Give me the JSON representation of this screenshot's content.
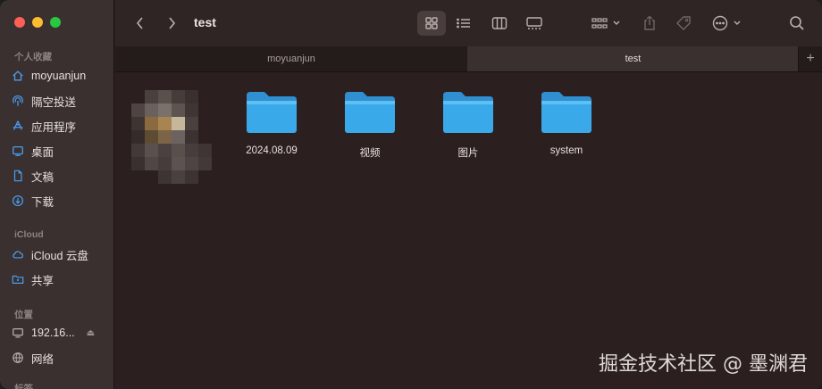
{
  "window": {
    "title": "test"
  },
  "sidebar": {
    "sections": [
      {
        "title": "个人收藏",
        "items": [
          {
            "label": "moyuanjun",
            "icon": "home-icon"
          },
          {
            "label": "隔空投送",
            "icon": "airdrop-icon"
          },
          {
            "label": "应用程序",
            "icon": "applications-icon"
          },
          {
            "label": "桌面",
            "icon": "desktop-icon"
          },
          {
            "label": "文稿",
            "icon": "document-icon"
          },
          {
            "label": "下载",
            "icon": "download-icon"
          }
        ]
      },
      {
        "title": "iCloud",
        "items": [
          {
            "label": "iCloud 云盘",
            "icon": "cloud-icon"
          },
          {
            "label": "共享",
            "icon": "shared-folder-icon"
          }
        ]
      },
      {
        "title": "位置",
        "items": [
          {
            "label": "192.16...",
            "icon": "display-icon"
          },
          {
            "label": "网络",
            "icon": "globe-icon"
          }
        ]
      },
      {
        "title": "标签",
        "items": []
      }
    ]
  },
  "tabs": [
    {
      "label": "moyuanjun",
      "active": false
    },
    {
      "label": "test",
      "active": true
    }
  ],
  "files": [
    {
      "name": "2024.08.09",
      "kind": "folder"
    },
    {
      "name": "视频",
      "kind": "folder"
    },
    {
      "name": "图片",
      "kind": "folder"
    },
    {
      "name": "system",
      "kind": "folder"
    }
  ],
  "watermark": "掘金技术社区 @ 墨渊君",
  "colors": {
    "folder": "#3aa9ea",
    "folder_top": "#5cc0f5",
    "accent": "#4a9df0"
  }
}
